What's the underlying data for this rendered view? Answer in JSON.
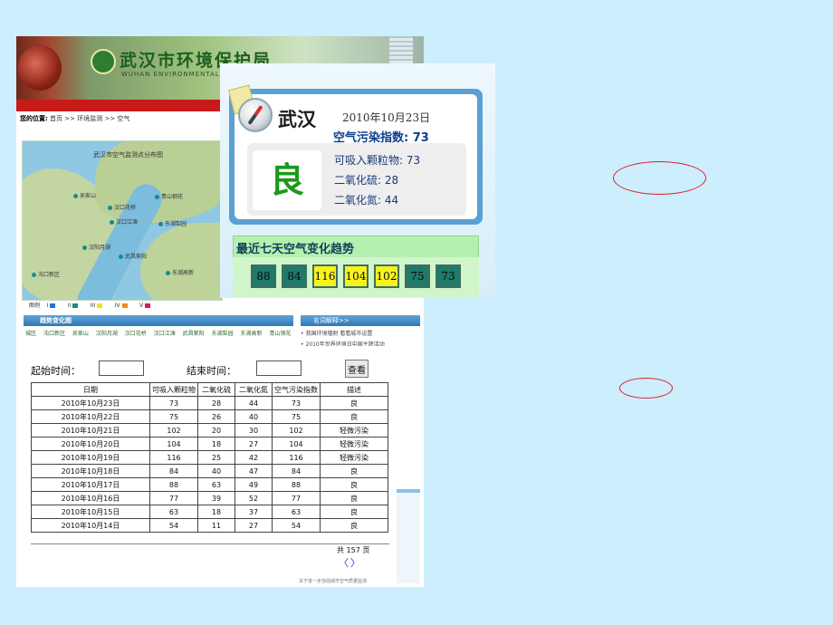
{
  "portal": {
    "title": "武汉市环境保护局",
    "subtitle": "WUHAN ENVIRONMENTAL PROTECTION BUREAU",
    "breadcrumb_label": "您的位置:",
    "breadcrumb_path": "首页 >> 环境监测 >> 空气",
    "map_title": "武汉市空气监测点分布图",
    "map_sites": [
      "吴家山",
      "汉口花桥",
      "青山钢花",
      "汉口江滩",
      "东湖梨园",
      "沌口新区",
      "汉阳月湖",
      "武昌紫阳",
      "东湖高新"
    ],
    "legend_label": "图例",
    "legend_items": [
      "I",
      "II",
      "III",
      "IV",
      "V"
    ],
    "trend_panel_title": "趋势变化图",
    "districts_label": "城区",
    "districts": [
      "沌口新区",
      "吴家山",
      "汉阳月湖",
      "汉口花桥",
      "汉口江滩",
      "武昌紫阳",
      "东湖梨园",
      "东湖高新",
      "青山钢花"
    ],
    "news_title": "名词解释>>",
    "news_items": [
      "我国环境辐射 看看城市设置",
      "2010年世界环境日中国主题活动"
    ],
    "footer_note": "关于进一步加强城市空气质量监测"
  },
  "query": {
    "start_label": "起始时间：",
    "end_label": "结束时间：",
    "search_button": "查看",
    "start_value": "",
    "end_value": ""
  },
  "table": {
    "columns": [
      "日期",
      "可吸入颗粒物",
      "二氧化硫",
      "二氧化氮",
      "空气污染指数",
      "描述"
    ],
    "rows": [
      [
        "2010年10月23日",
        "73",
        "28",
        "44",
        "73",
        "良"
      ],
      [
        "2010年10月22日",
        "75",
        "26",
        "40",
        "75",
        "良"
      ],
      [
        "2010年10月21日",
        "102",
        "20",
        "30",
        "102",
        "轻微污染"
      ],
      [
        "2010年10月20日",
        "104",
        "18",
        "27",
        "104",
        "轻微污染"
      ],
      [
        "2010年10月19日",
        "116",
        "25",
        "42",
        "116",
        "轻微污染"
      ],
      [
        "2010年10月18日",
        "84",
        "40",
        "47",
        "84",
        "良"
      ],
      [
        "2010年10月17日",
        "88",
        "63",
        "49",
        "88",
        "良"
      ],
      [
        "2010年10月16日",
        "77",
        "39",
        "52",
        "77",
        "良"
      ],
      [
        "2010年10月15日",
        "63",
        "18",
        "37",
        "63",
        "良"
      ],
      [
        "2010年10月14日",
        "54",
        "11",
        "27",
        "54",
        "良"
      ]
    ],
    "pager_text": "共 157 页",
    "prev": "〈",
    "next": "〉"
  },
  "card": {
    "city": "武汉",
    "date": "2010年10月23日",
    "aqi_label": "空气污染指数:",
    "aqi_value": "73",
    "grade": "良",
    "pollutants": [
      {
        "name": "可吸入颗粒物:",
        "value": "73"
      },
      {
        "name": "二氧化硫:",
        "value": "28"
      },
      {
        "name": "二氧化氮:",
        "value": "44"
      }
    ],
    "trend_title": "最近七天空气变化趋势",
    "trend": [
      {
        "value": "88",
        "level": "good"
      },
      {
        "value": "84",
        "level": "good"
      },
      {
        "value": "116",
        "level": "mild"
      },
      {
        "value": "104",
        "level": "mild"
      },
      {
        "value": "102",
        "level": "mild"
      },
      {
        "value": "75",
        "level": "good"
      },
      {
        "value": "73",
        "level": "good"
      }
    ]
  },
  "colors": {
    "background": "#cdeefc",
    "good": "#1e7a6a",
    "mild_pollution": "#f7f21c",
    "annotation": "#e0202a"
  }
}
